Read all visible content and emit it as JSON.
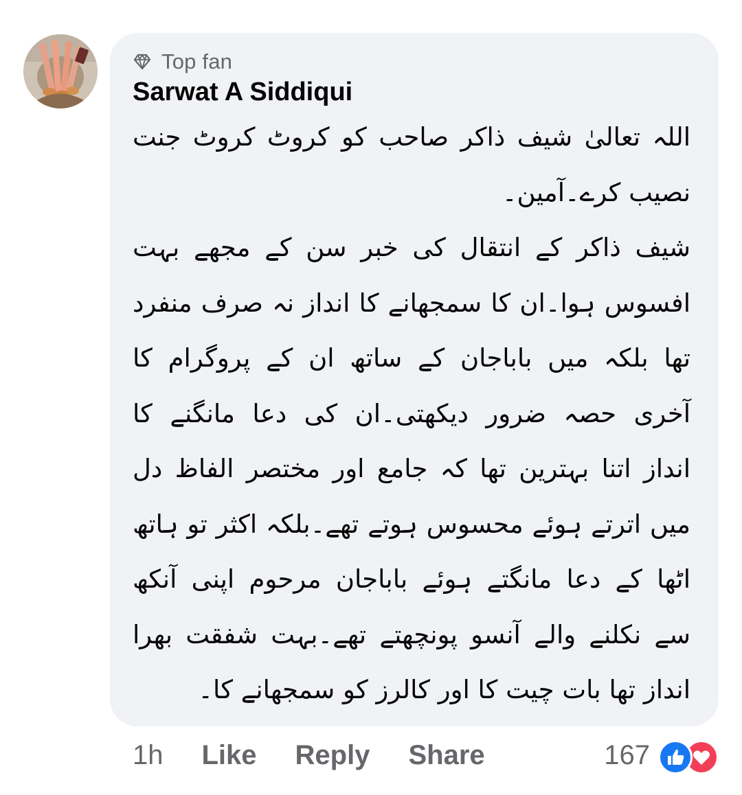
{
  "comment": {
    "badge": {
      "icon": "diamond-icon",
      "label": "Top fan"
    },
    "author": "Sarwat A Siddiqui",
    "body_lines": [
      "اللہ تعالیٰ شیف ذاکر صاحب کو کروٹ کروٹ جنت",
      "نصیب کرے۔آمین۔",
      "شیف ذاکر کے انتقال کی خبر سن کے مجھے بہت",
      "افسوس ہوا۔ان کا سمجھانے کا انداز نہ صرف منفرد",
      "تھا بلکہ میں باباجان کے ساتھ ان کے پروگرام کا",
      "آخری حصہ ضرور دیکھتی۔ان کی دعا مانگنے کا",
      "انداز اتنا بہترین تھا کہ جامع اور مختصر الفاظ دل",
      "میں اترتے ہوئے محسوس ہوتے تھے۔بلکہ اکثر تو ہاتھ",
      "اٹھا کے دعا مانگتے ہوئے باباجان مرحوم اپنی آنکھ",
      "سے نکلنے والے آنسو پونچھتے تھے۔بہت شفقت بھرا",
      "انداز تھا بات چیت کا اور کالرز کو سمجھانے کا۔"
    ],
    "bubble_color": "#f0f2f5"
  },
  "actions": {
    "time": "1h",
    "like": "Like",
    "reply": "Reply",
    "share": "Share"
  },
  "reactions": {
    "count": "167",
    "types": [
      "like-reaction-icon",
      "love-reaction-icon"
    ],
    "like_color": "#1877f2",
    "love_color": "#f33e58"
  }
}
